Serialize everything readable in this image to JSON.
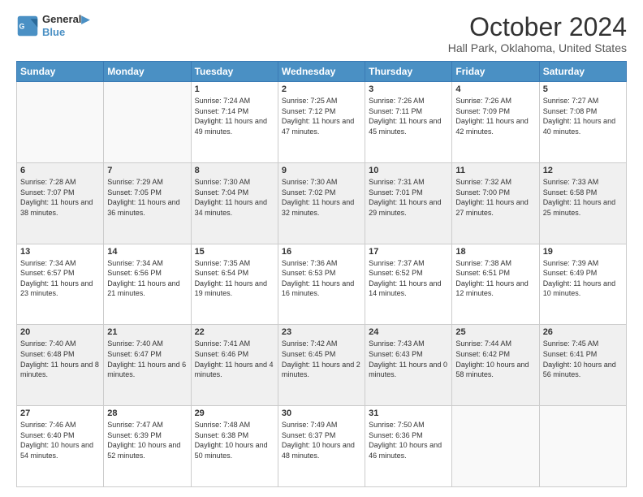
{
  "header": {
    "logo_line1": "General",
    "logo_line2": "Blue",
    "title": "October 2024",
    "subtitle": "Hall Park, Oklahoma, United States"
  },
  "weekdays": [
    "Sunday",
    "Monday",
    "Tuesday",
    "Wednesday",
    "Thursday",
    "Friday",
    "Saturday"
  ],
  "weeks": [
    [
      {
        "day": "",
        "info": ""
      },
      {
        "day": "",
        "info": ""
      },
      {
        "day": "1",
        "info": "Sunrise: 7:24 AM\nSunset: 7:14 PM\nDaylight: 11 hours and 49 minutes."
      },
      {
        "day": "2",
        "info": "Sunrise: 7:25 AM\nSunset: 7:12 PM\nDaylight: 11 hours and 47 minutes."
      },
      {
        "day": "3",
        "info": "Sunrise: 7:26 AM\nSunset: 7:11 PM\nDaylight: 11 hours and 45 minutes."
      },
      {
        "day": "4",
        "info": "Sunrise: 7:26 AM\nSunset: 7:09 PM\nDaylight: 11 hours and 42 minutes."
      },
      {
        "day": "5",
        "info": "Sunrise: 7:27 AM\nSunset: 7:08 PM\nDaylight: 11 hours and 40 minutes."
      }
    ],
    [
      {
        "day": "6",
        "info": "Sunrise: 7:28 AM\nSunset: 7:07 PM\nDaylight: 11 hours and 38 minutes."
      },
      {
        "day": "7",
        "info": "Sunrise: 7:29 AM\nSunset: 7:05 PM\nDaylight: 11 hours and 36 minutes."
      },
      {
        "day": "8",
        "info": "Sunrise: 7:30 AM\nSunset: 7:04 PM\nDaylight: 11 hours and 34 minutes."
      },
      {
        "day": "9",
        "info": "Sunrise: 7:30 AM\nSunset: 7:02 PM\nDaylight: 11 hours and 32 minutes."
      },
      {
        "day": "10",
        "info": "Sunrise: 7:31 AM\nSunset: 7:01 PM\nDaylight: 11 hours and 29 minutes."
      },
      {
        "day": "11",
        "info": "Sunrise: 7:32 AM\nSunset: 7:00 PM\nDaylight: 11 hours and 27 minutes."
      },
      {
        "day": "12",
        "info": "Sunrise: 7:33 AM\nSunset: 6:58 PM\nDaylight: 11 hours and 25 minutes."
      }
    ],
    [
      {
        "day": "13",
        "info": "Sunrise: 7:34 AM\nSunset: 6:57 PM\nDaylight: 11 hours and 23 minutes."
      },
      {
        "day": "14",
        "info": "Sunrise: 7:34 AM\nSunset: 6:56 PM\nDaylight: 11 hours and 21 minutes."
      },
      {
        "day": "15",
        "info": "Sunrise: 7:35 AM\nSunset: 6:54 PM\nDaylight: 11 hours and 19 minutes."
      },
      {
        "day": "16",
        "info": "Sunrise: 7:36 AM\nSunset: 6:53 PM\nDaylight: 11 hours and 16 minutes."
      },
      {
        "day": "17",
        "info": "Sunrise: 7:37 AM\nSunset: 6:52 PM\nDaylight: 11 hours and 14 minutes."
      },
      {
        "day": "18",
        "info": "Sunrise: 7:38 AM\nSunset: 6:51 PM\nDaylight: 11 hours and 12 minutes."
      },
      {
        "day": "19",
        "info": "Sunrise: 7:39 AM\nSunset: 6:49 PM\nDaylight: 11 hours and 10 minutes."
      }
    ],
    [
      {
        "day": "20",
        "info": "Sunrise: 7:40 AM\nSunset: 6:48 PM\nDaylight: 11 hours and 8 minutes."
      },
      {
        "day": "21",
        "info": "Sunrise: 7:40 AM\nSunset: 6:47 PM\nDaylight: 11 hours and 6 minutes."
      },
      {
        "day": "22",
        "info": "Sunrise: 7:41 AM\nSunset: 6:46 PM\nDaylight: 11 hours and 4 minutes."
      },
      {
        "day": "23",
        "info": "Sunrise: 7:42 AM\nSunset: 6:45 PM\nDaylight: 11 hours and 2 minutes."
      },
      {
        "day": "24",
        "info": "Sunrise: 7:43 AM\nSunset: 6:43 PM\nDaylight: 11 hours and 0 minutes."
      },
      {
        "day": "25",
        "info": "Sunrise: 7:44 AM\nSunset: 6:42 PM\nDaylight: 10 hours and 58 minutes."
      },
      {
        "day": "26",
        "info": "Sunrise: 7:45 AM\nSunset: 6:41 PM\nDaylight: 10 hours and 56 minutes."
      }
    ],
    [
      {
        "day": "27",
        "info": "Sunrise: 7:46 AM\nSunset: 6:40 PM\nDaylight: 10 hours and 54 minutes."
      },
      {
        "day": "28",
        "info": "Sunrise: 7:47 AM\nSunset: 6:39 PM\nDaylight: 10 hours and 52 minutes."
      },
      {
        "day": "29",
        "info": "Sunrise: 7:48 AM\nSunset: 6:38 PM\nDaylight: 10 hours and 50 minutes."
      },
      {
        "day": "30",
        "info": "Sunrise: 7:49 AM\nSunset: 6:37 PM\nDaylight: 10 hours and 48 minutes."
      },
      {
        "day": "31",
        "info": "Sunrise: 7:50 AM\nSunset: 6:36 PM\nDaylight: 10 hours and 46 minutes."
      },
      {
        "day": "",
        "info": ""
      },
      {
        "day": "",
        "info": ""
      }
    ]
  ]
}
